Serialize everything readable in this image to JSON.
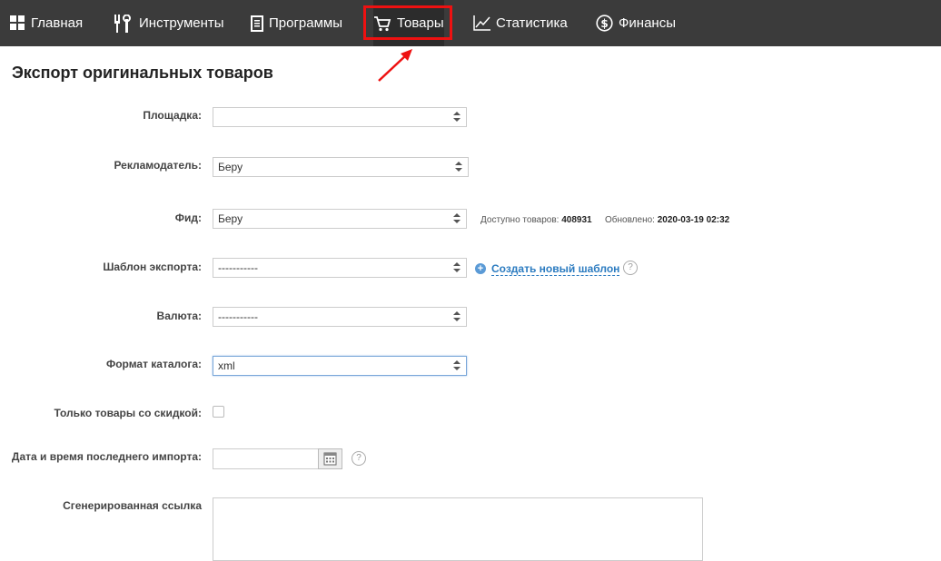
{
  "nav": {
    "items": [
      {
        "label": "Главная",
        "icon": "grid-icon"
      },
      {
        "label": "Инструменты",
        "icon": "tools-icon"
      },
      {
        "label": "Программы",
        "icon": "document-icon"
      },
      {
        "label": "Товары",
        "icon": "cart-icon",
        "active": true
      },
      {
        "label": "Статистика",
        "icon": "chart-icon"
      },
      {
        "label": "Финансы",
        "icon": "dollar-icon"
      }
    ]
  },
  "page": {
    "title": "Экспорт оригинальных товаров"
  },
  "form": {
    "platform": {
      "label": "Площадка:",
      "value": ""
    },
    "advertiser": {
      "label": "Рекламодатель:",
      "value": "Беру"
    },
    "feed": {
      "label": "Фид:",
      "value": "Беру",
      "available_label": "Доступно товаров:",
      "available_value": "408931",
      "updated_label": "Обновлено:",
      "updated_value": "2020-03-19 02:32"
    },
    "template": {
      "label": "Шаблон экспорта:",
      "value": "-----------",
      "create_link": "Создать новый шаблон"
    },
    "currency": {
      "label": "Валюта:",
      "value": "-----------"
    },
    "format": {
      "label": "Формат каталога:",
      "value": "xml"
    },
    "discount_only": {
      "label": "Только товары со скидкой:",
      "checked": false
    },
    "last_import": {
      "label": "Дата и время последнего импорта:",
      "value": ""
    },
    "generated_link": {
      "label": "Сгенерированная ссылка",
      "value": ""
    }
  },
  "colors": {
    "nav_bg": "#3b3b3b",
    "highlight": "#ee1111",
    "link": "#2b7bc0"
  }
}
